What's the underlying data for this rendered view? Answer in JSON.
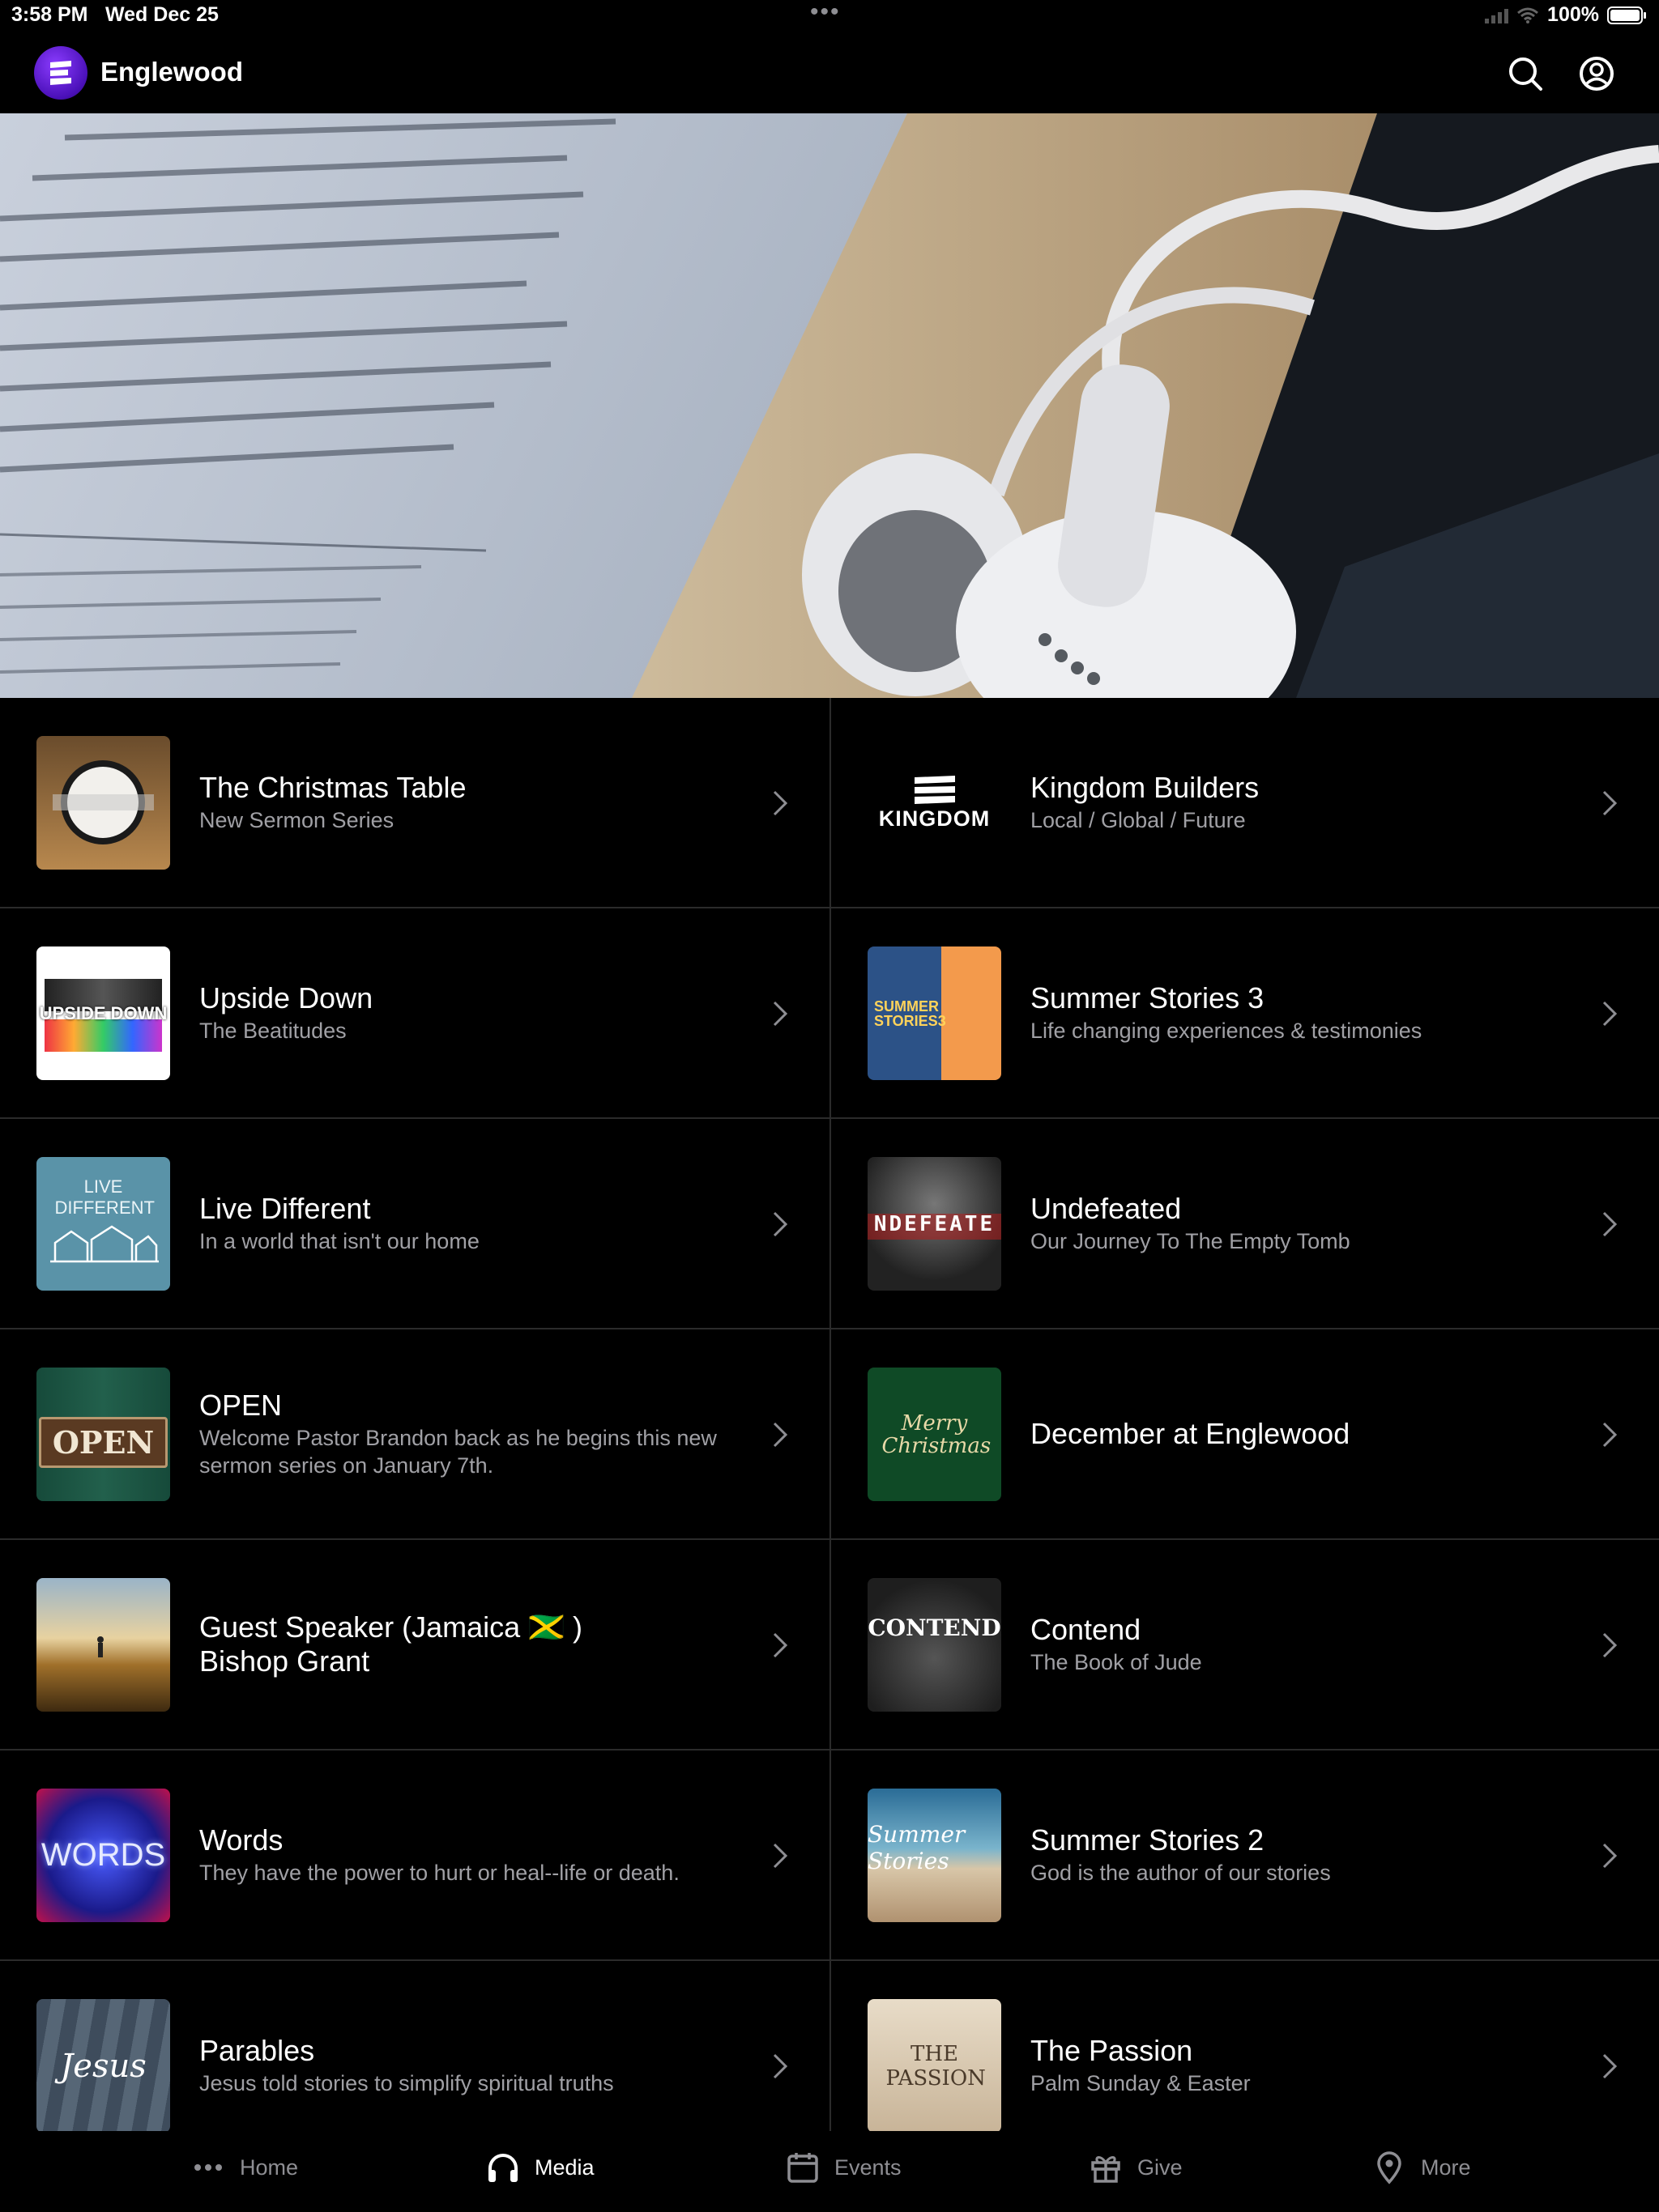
{
  "status": {
    "time": "3:58 PM",
    "date": "Wed Dec 25",
    "battery": "100%"
  },
  "header": {
    "title": "Englewood",
    "logo_icon": "church-logo-icon",
    "search_icon": "search-icon",
    "profile_icon": "profile-icon"
  },
  "hero": {
    "image": "bible-and-earbuds-photo"
  },
  "media_items": [
    {
      "title": "The Christmas Table",
      "subtitle": "New Sermon Series",
      "thumb_color": "#a07a4c",
      "thumb_text": ""
    },
    {
      "title": "Kingdom Builders",
      "subtitle": "Local / Global / Future",
      "thumb_color": "#000000",
      "thumb_text": "KINGDOM"
    },
    {
      "title": "Upside Down",
      "subtitle": "The Beatitudes",
      "thumb_color": "#ffffff",
      "thumb_text": "UPSIDE DOWN"
    },
    {
      "title": "Summer Stories 3",
      "subtitle": "Life changing experiences & testimonies",
      "thumb_color": "#2e5a8e",
      "thumb_text": "SUMMER STORIES3"
    },
    {
      "title": "Live Different",
      "subtitle": "In a world that isn't our home",
      "thumb_color": "#5a93a8",
      "thumb_text": "LIVE DIFFERENT"
    },
    {
      "title": "Undefeated",
      "subtitle": "Our Journey To The Empty Tomb",
      "thumb_color": "#3a3a3a",
      "thumb_text": "NDEFEATE"
    },
    {
      "title": "OPEN",
      "subtitle": "Welcome Pastor Brandon back as he begins this new sermon series on January 7th.",
      "thumb_color": "#1e5a48",
      "thumb_text": "OPEN"
    },
    {
      "title": "December at Englewood",
      "subtitle": "",
      "thumb_color": "#0f4a26",
      "thumb_text": "Merry Christmas"
    },
    {
      "title": "Guest Speaker (Jamaica 🇯🇲 ) Bishop Grant",
      "subtitle": "",
      "thumb_color": "#8a6a38",
      "thumb_text": ""
    },
    {
      "title": "Contend",
      "subtitle": "The Book of Jude",
      "thumb_color": "#2a2a2a",
      "thumb_text": "CONTEND"
    },
    {
      "title": "Words",
      "subtitle": "They have the power to hurt or heal--life or death.",
      "thumb_color": "#2838c8",
      "thumb_text": "WORDS"
    },
    {
      "title": "Summer Stories 2",
      "subtitle": "God is the author of our stories",
      "thumb_color": "#3a7aa0",
      "thumb_text": "Summer Stories"
    },
    {
      "title": "Parables",
      "subtitle": "Jesus told stories to simplify spiritual truths",
      "thumb_color": "#4a5a6a",
      "thumb_text": "Jesus"
    },
    {
      "title": "The Passion",
      "subtitle": "Palm Sunday & Easter",
      "thumb_color": "#d8cab4",
      "thumb_text": "THE PASSION"
    }
  ],
  "tabs": [
    {
      "label": "Home",
      "icon": "more-dots-icon",
      "active": false
    },
    {
      "label": "Media",
      "icon": "headphones-icon",
      "active": true
    },
    {
      "label": "Events",
      "icon": "calendar-icon",
      "active": false
    },
    {
      "label": "Give",
      "icon": "gift-icon",
      "active": false
    },
    {
      "label": "More",
      "icon": "location-pin-icon",
      "active": false
    }
  ]
}
